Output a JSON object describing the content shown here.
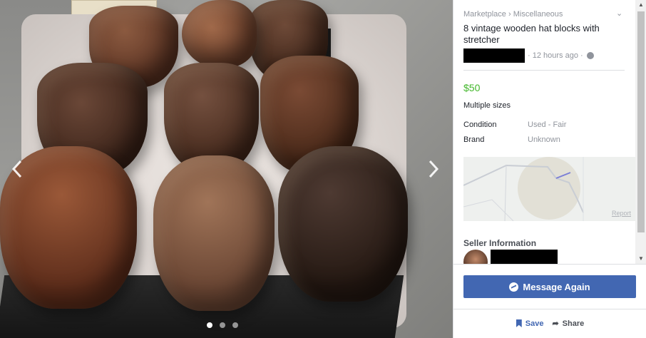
{
  "photo": {
    "prev_icon": "chevron-left-icon",
    "next_icon": "chevron-right-icon",
    "image_count": 3,
    "active_index": 0
  },
  "listing": {
    "breadcrumb": [
      "Marketplace",
      "Miscellaneous"
    ],
    "breadcrumb_separator": "›",
    "title": "8 vintage wooden hat blocks with stretcher",
    "posted": "· 12 hours ago ·",
    "price": "$50",
    "description": "Multiple sizes",
    "details": [
      {
        "label": "Condition",
        "value": "Used - Fair"
      },
      {
        "label": "Brand",
        "value": "Unknown"
      }
    ],
    "map_report": "Report"
  },
  "seller": {
    "heading": "Seller Information"
  },
  "actions": {
    "message_label": "Message Again",
    "save_label": "Save",
    "share_label": "Share"
  },
  "colors": {
    "accent": "#4267b2",
    "price": "#42b72a",
    "muted": "#90949c"
  }
}
